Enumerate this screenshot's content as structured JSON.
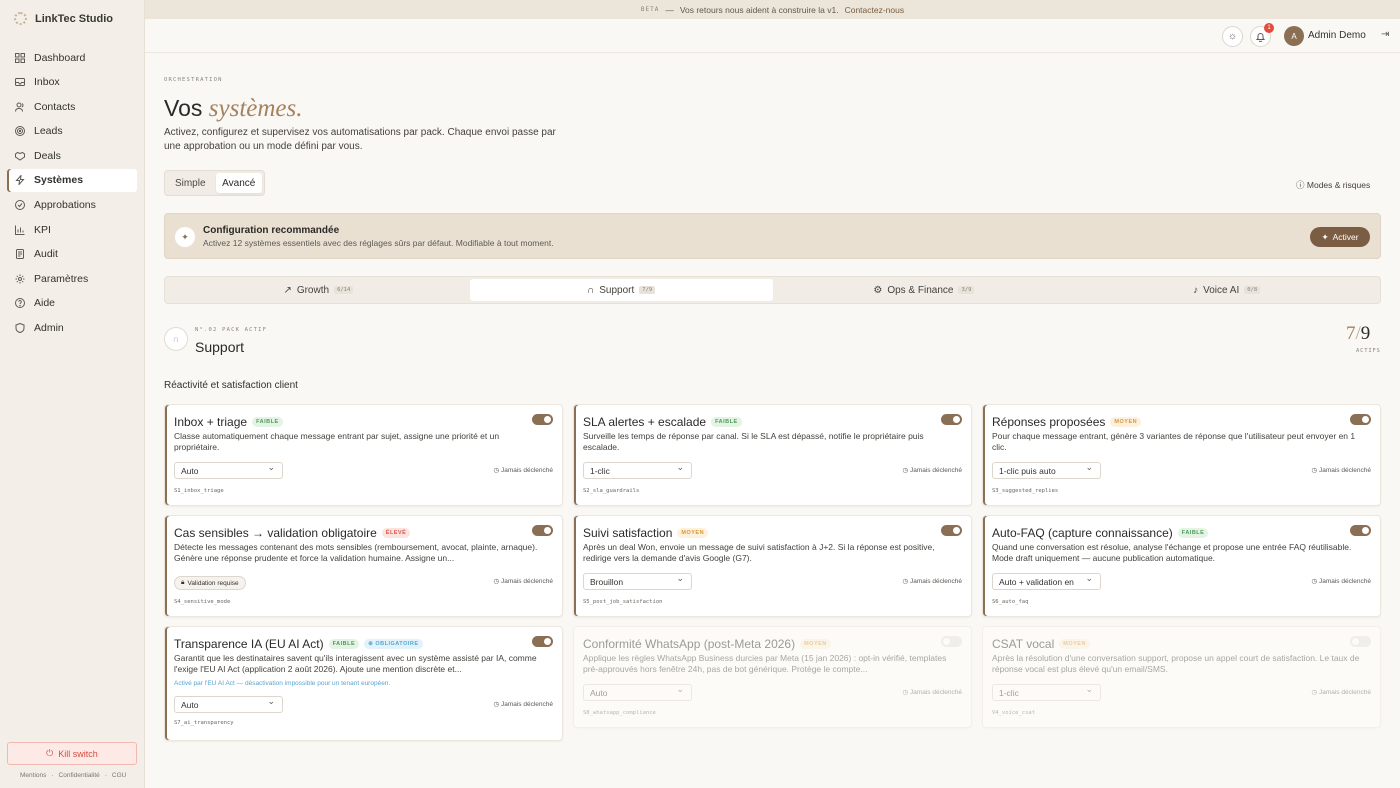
{
  "app": {
    "name": "LinkTec Studio"
  },
  "banner": {
    "beta": "BETA",
    "dash": "—",
    "text": "Vos retours nous aident à construire la v1.",
    "link": "Contactez-nous"
  },
  "nav": [
    {
      "label": "Dashboard",
      "icon": "grid-icon"
    },
    {
      "label": "Inbox",
      "icon": "inbox-icon"
    },
    {
      "label": "Contacts",
      "icon": "users-icon"
    },
    {
      "label": "Leads",
      "icon": "target-icon"
    },
    {
      "label": "Deals",
      "icon": "handshake-icon"
    },
    {
      "label": "Systèmes",
      "icon": "bolt-icon",
      "active": true
    },
    {
      "label": "Approbations",
      "icon": "check-circle-icon"
    },
    {
      "label": "KPI",
      "icon": "bar-chart-icon"
    },
    {
      "label": "Audit",
      "icon": "scroll-icon"
    },
    {
      "label": "Paramètres",
      "icon": "gear-icon"
    },
    {
      "label": "Aide",
      "icon": "help-icon"
    },
    {
      "label": "Admin",
      "icon": "shield-icon"
    }
  ],
  "kill_switch": "Kill switch",
  "footer_links": [
    "Mentions",
    "·",
    "Confidentialité",
    "·",
    "CGU"
  ],
  "topbar": {
    "notif_count": "1",
    "avatar_initial": "A",
    "username": "Admin Demo"
  },
  "page": {
    "eyebrow": "ORCHESTRATION",
    "title_plain": "Vos",
    "title_em": "systèmes.",
    "description": "Activez, configurez et supervisez vos automatisations par pack. Chaque envoi passe par une approbation ou un mode défini par vous.",
    "mode_simple": "Simple",
    "mode_advanced": "Avancé",
    "modes_risques": "Modes & risques"
  },
  "recommended": {
    "title": "Configuration recommandée",
    "subtitle": "Activez 12 systèmes essentiels avec des réglages sûrs par défaut. Modifiable à tout moment.",
    "button": "Activer"
  },
  "packs": [
    {
      "label": "Growth",
      "count": "6/14"
    },
    {
      "label": "Support",
      "count": "7/9",
      "active": true
    },
    {
      "label": "Ops & Finance",
      "count": "3/9"
    },
    {
      "label": "Voice AI",
      "count": "0/8"
    }
  ],
  "active_pack": {
    "eyebrow": "N°.02 PACK ACTIF",
    "title": "Support",
    "active_num": "7",
    "sep": "/",
    "total": "9",
    "actifs_label": "ACTIFS",
    "section": "Réactivité et satisfaction client"
  },
  "cards": [
    {
      "title": "Inbox + triage",
      "badge": "FAIBLE",
      "level": "faible",
      "desc": "Classe automatiquement chaque message entrant par sujet, assigne une priorité et un propriétaire.",
      "mode": "Auto",
      "status": "Jamais déclenché",
      "slug": "S1_inbox_triage",
      "on": true
    },
    {
      "title": "SLA alertes + escalade",
      "badge": "FAIBLE",
      "level": "faible",
      "desc": "Surveille les temps de réponse par canal. Si le SLA est dépassé, notifie le propriétaire puis escalade.",
      "mode": "1-clic",
      "status": "Jamais déclenché",
      "slug": "S2_sla_guardrails",
      "on": true
    },
    {
      "title": "Réponses proposées",
      "badge": "MOYEN",
      "level": "moyen",
      "desc": "Pour chaque message entrant, génère 3 variantes de réponse que l'utilisateur peut envoyer en 1 clic.",
      "mode": "1-clic puis auto",
      "status": "Jamais déclenché",
      "slug": "S3_suggested_replies",
      "on": true
    },
    {
      "title": "Cas sensibles → validation obligatoire",
      "badge": "ÉLEVÉ",
      "level": "eleve",
      "desc": "Détecte les messages contenant des mots sensibles (remboursement, avocat, plainte, arnaque). Génère une réponse prudente et force la validation humaine. Assigne un...",
      "pill": "Validation requise",
      "status": "Jamais déclenché",
      "slug": "S4_sensitive_mode",
      "on": true
    },
    {
      "title": "Suivi satisfaction",
      "badge": "MOYEN",
      "level": "moyen",
      "desc": "Après un deal Won, envoie un message de suivi satisfaction à J+2. Si la réponse est positive, redirige vers la demande d'avis Google (G7).",
      "mode": "Brouillon",
      "status": "Jamais déclenché",
      "slug": "S5_post_job_satisfaction",
      "on": true
    },
    {
      "title": "Auto-FAQ (capture connaissance)",
      "badge": "FAIBLE",
      "level": "faible",
      "desc": "Quand une conversation est résolue, analyse l'échange et propose une entrée FAQ réutilisable. Mode draft uniquement — aucune publication automatique.",
      "mode": "Auto + validation en",
      "status": "Jamais déclenché",
      "slug": "S6_auto_faq",
      "on": true
    },
    {
      "title": "Transparence IA (EU AI Act)",
      "badge": "FAIBLE",
      "badge2": "OBLIGATOIRE",
      "level": "faible",
      "desc": "Garantit que les destinataires savent qu'ils interagissent avec un système assisté par IA, comme l'exige l'EU AI Act (application 2 août 2026). Ajoute une mention discrète et...",
      "note": "Activé par l'EU AI Act — désactivation impossible pour un tenant européen.",
      "mode": "Auto",
      "status": "Jamais déclenché",
      "slug": "S7_ai_transparency",
      "on": true
    },
    {
      "title": "Conformité WhatsApp (post-Meta 2026)",
      "badge": "MOYEN",
      "level": "moyen",
      "desc": "Applique les règles WhatsApp Business durcies par Meta (15 jan 2026) : opt-in vérifié, templates pré-approuvés hors fenêtre 24h, pas de bot générique. Protège le compte...",
      "mode": "Auto",
      "status": "Jamais déclenché",
      "slug": "S8_whatsapp_compliance",
      "on": false
    },
    {
      "title": "CSAT vocal",
      "badge": "MOYEN",
      "level": "moyen",
      "desc": "Après la résolution d'une conversation support, propose un appel court de satisfaction. Le taux de réponse vocal est plus élevé qu'un email/SMS.",
      "mode": "1-clic",
      "status": "Jamais déclenché",
      "slug": "V4_voice_csat",
      "on": false
    }
  ]
}
